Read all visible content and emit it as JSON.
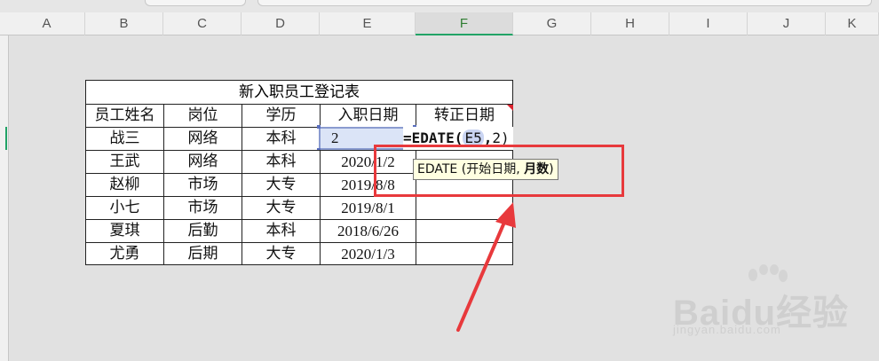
{
  "columns": [
    "A",
    "B",
    "C",
    "D",
    "E",
    "F",
    "G",
    "H",
    "I",
    "J",
    "K"
  ],
  "active_column": "F",
  "table": {
    "title": "新入职员工登记表",
    "headers": [
      "员工姓名",
      "岗位",
      "学历",
      "入职日期",
      "转正日期"
    ],
    "rows": [
      [
        "战三",
        "网络",
        "本科",
        "2",
        ""
      ],
      [
        "王武",
        "网络",
        "本科",
        "2020/1/2",
        ""
      ],
      [
        "赵柳",
        "市场",
        "大专",
        "2019/8/8",
        ""
      ],
      [
        "小七",
        "市场",
        "大专",
        "2019/8/1",
        ""
      ],
      [
        "夏琪",
        "后勤",
        "本科",
        "2018/6/26",
        ""
      ],
      [
        "尤勇",
        "后期",
        "大专",
        "2020/1/3",
        ""
      ]
    ]
  },
  "formula": {
    "prefix": "=EDATE(",
    "ref": "E5",
    "separator": ",",
    "arg2": "2)"
  },
  "tooltip": {
    "func": "EDATE",
    "paren_open": " (开始日期, ",
    "bold_arg": "月数",
    "paren_close": ")"
  },
  "watermark": {
    "brand": "Baidu经验",
    "url": "jingyan.baidu.com"
  },
  "colors": {
    "annotation_red": "#e8393c",
    "selection_blue": "#dbe4f7",
    "active_header_green": "#21a366",
    "tooltip_bg": "#ffffe1"
  }
}
